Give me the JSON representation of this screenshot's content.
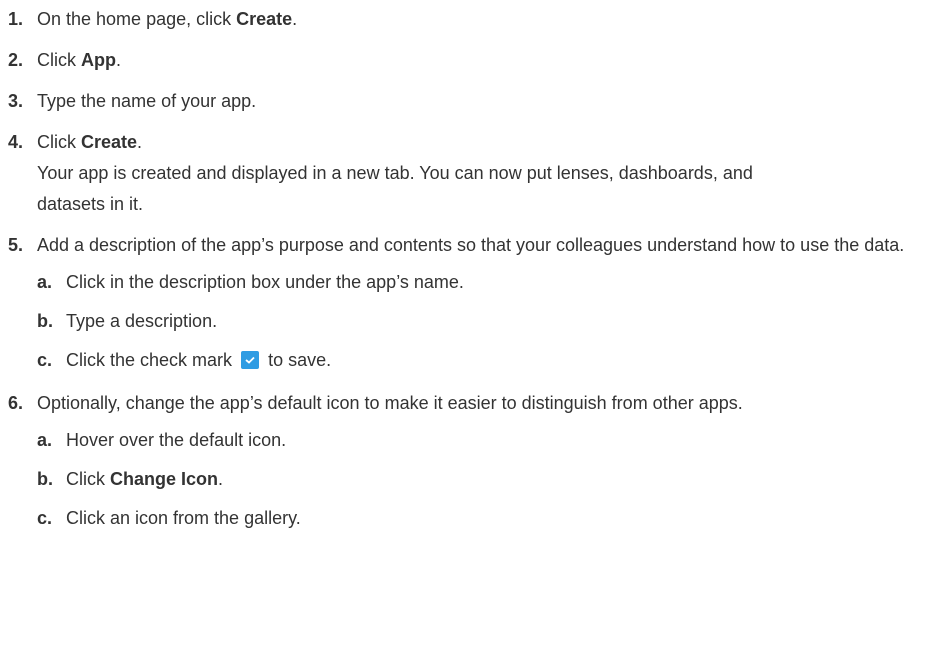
{
  "steps": [
    {
      "num": "1.",
      "pre": "On the home page, click ",
      "bold": "Create",
      "post": "."
    },
    {
      "num": "2.",
      "pre": "Click ",
      "bold": "App",
      "post": "."
    },
    {
      "num": "3.",
      "text": "Type the name of your app."
    },
    {
      "num": "4.",
      "pre": "Click ",
      "bold": "Create",
      "post": ".",
      "desc": "Your app is created and displayed in a new tab. You can now put lenses, dashboards, and datasets in it."
    },
    {
      "num": "5.",
      "text": "Add a description of the app’s purpose and contents so that your colleagues understand how to use the data.",
      "sub": [
        {
          "num": "a.",
          "text": "Click in the description box under the app’s name."
        },
        {
          "num": "b.",
          "text": "Type a description."
        },
        {
          "num": "c.",
          "pre": "Click the check mark",
          "post": "to save.",
          "icon": "check-mark-icon"
        }
      ]
    },
    {
      "num": "6.",
      "text": "Optionally, change the app’s default icon to make it easier to distinguish from other apps.",
      "sub": [
        {
          "num": "a.",
          "text": "Hover over the default icon."
        },
        {
          "num": "b.",
          "pre": "Click ",
          "bold": "Change Icon",
          "post": "."
        },
        {
          "num": "c.",
          "text": "Click an icon from the gallery."
        }
      ]
    }
  ],
  "colors": {
    "text": "#333333",
    "check_icon_bg": "#2f9ce3"
  }
}
